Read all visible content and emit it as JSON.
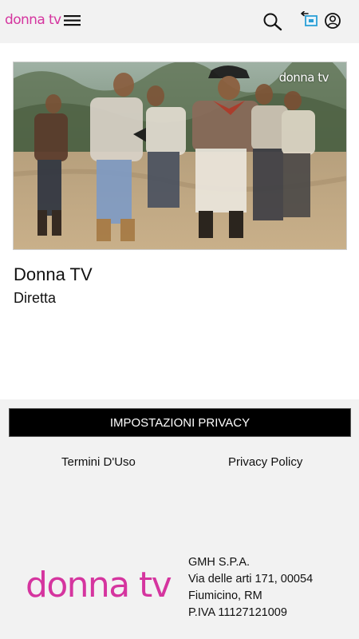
{
  "header": {
    "logo_text": "donna tv",
    "icons": [
      "hamburger-menu-icon",
      "search-icon",
      "cast-icon",
      "user-account-icon"
    ]
  },
  "player": {
    "watermark": "donna tv"
  },
  "content": {
    "title": "Donna TV",
    "subtitle": "Diretta"
  },
  "footer": {
    "privacy_button": "IMPOSTAZIONI PRIVACY",
    "links": [
      "Termini D'Uso",
      "Privacy Policy"
    ],
    "logo_text": "donna tv",
    "company": {
      "name": "GMH S.P.A.",
      "address": "Via delle arti 171, 00054",
      "city": "Fiumicino, RM",
      "vat": "P.IVA 11127121009"
    }
  },
  "colors": {
    "brand": "#d5359f",
    "header_bg": "#f2f2f2",
    "button_bg": "#000000"
  }
}
